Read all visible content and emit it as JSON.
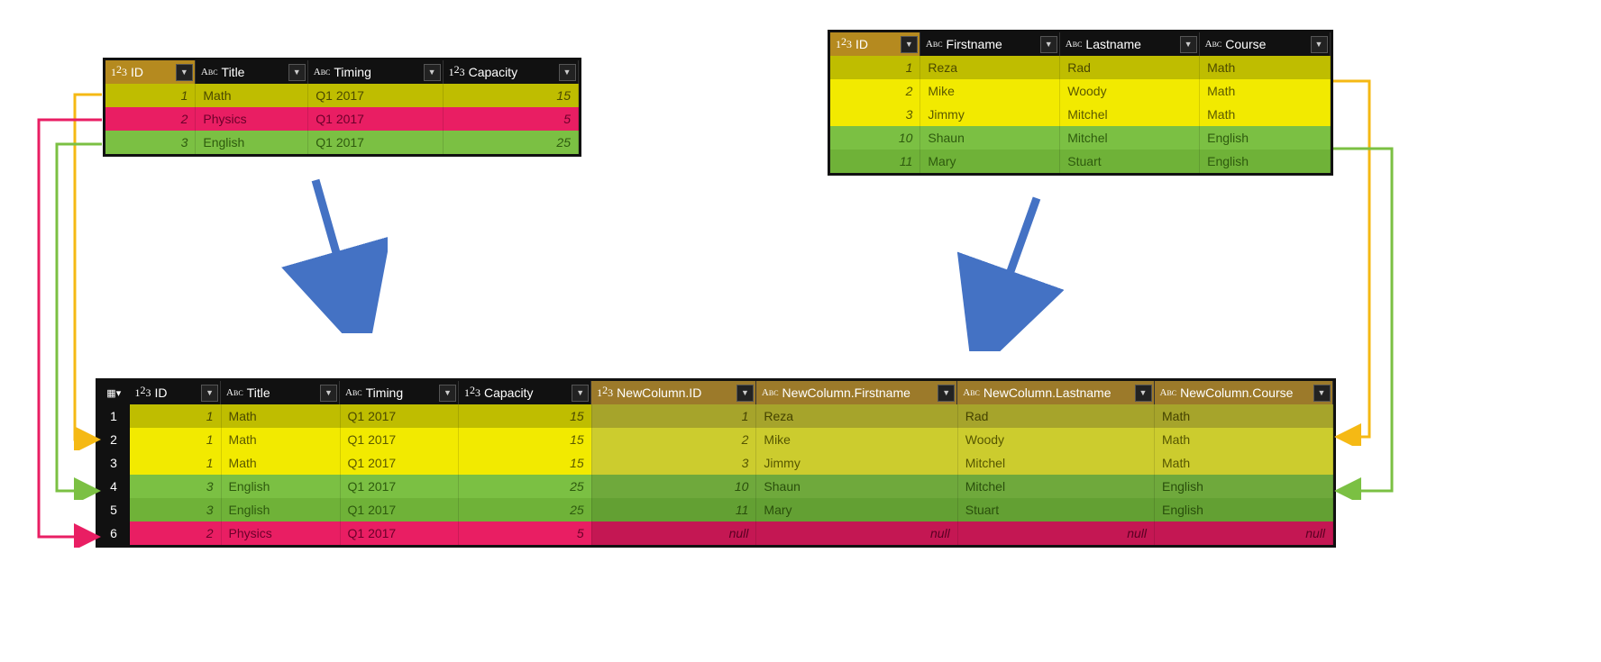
{
  "tableA": {
    "cols": [
      {
        "type": "num",
        "label": "ID",
        "sel": true
      },
      {
        "type": "txt",
        "label": "Title"
      },
      {
        "type": "txt",
        "label": "Timing"
      },
      {
        "type": "num",
        "label": "Capacity"
      }
    ],
    "rows": [
      {
        "cls": "row-o",
        "cells": [
          "1",
          "Math",
          "Q1 2017",
          "15"
        ]
      },
      {
        "cls": "row-p",
        "cells": [
          "2",
          "Physics",
          "Q1 2017",
          "5"
        ]
      },
      {
        "cls": "row-g",
        "cells": [
          "3",
          "English",
          "Q1 2017",
          "25"
        ]
      }
    ]
  },
  "tableB": {
    "cols": [
      {
        "type": "num",
        "label": "ID",
        "sel": true
      },
      {
        "type": "txt",
        "label": "Firstname"
      },
      {
        "type": "txt",
        "label": "Lastname"
      },
      {
        "type": "txt",
        "label": "Course"
      }
    ],
    "rows": [
      {
        "cls": "row-o",
        "cells": [
          "1",
          "Reza",
          "Rad",
          "Math"
        ]
      },
      {
        "cls": "row-y",
        "cells": [
          "2",
          "Mike",
          "Woody",
          "Math"
        ]
      },
      {
        "cls": "row-y",
        "cells": [
          "3",
          "Jimmy",
          "Mitchel",
          "Math"
        ]
      },
      {
        "cls": "row-g",
        "cells": [
          "10",
          "Shaun",
          "Mitchel",
          "English"
        ]
      },
      {
        "cls": "row-g2",
        "cells": [
          "11",
          "Mary",
          "Stuart",
          "English"
        ]
      }
    ]
  },
  "tableC": {
    "cols": [
      {
        "type": "num",
        "label": "ID",
        "rn": false
      },
      {
        "type": "txt",
        "label": "Title"
      },
      {
        "type": "txt",
        "label": "Timing"
      },
      {
        "type": "num",
        "label": "Capacity"
      },
      {
        "type": "num",
        "label": "NewColumn.ID",
        "sel2": true
      },
      {
        "type": "txt",
        "label": "NewColumn.Firstname",
        "sel2": true
      },
      {
        "type": "txt",
        "label": "NewColumn.Lastname",
        "sel2": true
      },
      {
        "type": "txt",
        "label": "NewColumn.Course",
        "sel2": true
      }
    ],
    "rownums": [
      "1",
      "2",
      "3",
      "4",
      "5",
      "6"
    ],
    "rows": [
      {
        "cls": "row-o",
        "cells": [
          "1",
          "Math",
          "Q1 2017",
          "15",
          "1",
          "Reza",
          "Rad",
          "Math"
        ]
      },
      {
        "cls": "row-y",
        "cells": [
          "2",
          "Mike",
          "Woody",
          "Math"
        ],
        "full": [
          "1",
          "Math",
          "Q1 2017",
          "15",
          "2",
          "Mike",
          "Woody",
          "Math"
        ]
      },
      {
        "cls": "row-y",
        "cells": [
          "1",
          "Math",
          "Q1 2017",
          "15",
          "3",
          "Jimmy",
          "Mitchel",
          "Math"
        ]
      },
      {
        "cls": "row-g",
        "cells": [
          "3",
          "English",
          "Q1 2017",
          "25",
          "10",
          "Shaun",
          "Mitchel",
          "English"
        ]
      },
      {
        "cls": "row-g2",
        "cells": [
          "3",
          "English",
          "Q1 2017",
          "25",
          "11",
          "Mary",
          "Stuart",
          "English"
        ]
      },
      {
        "cls": "row-p",
        "cells": [
          "2",
          "Physics",
          "Q1 2017",
          "5",
          "null",
          "null",
          "null",
          "null"
        ],
        "nulls": [
          4,
          5,
          6,
          7
        ]
      }
    ]
  },
  "null_label": "null"
}
